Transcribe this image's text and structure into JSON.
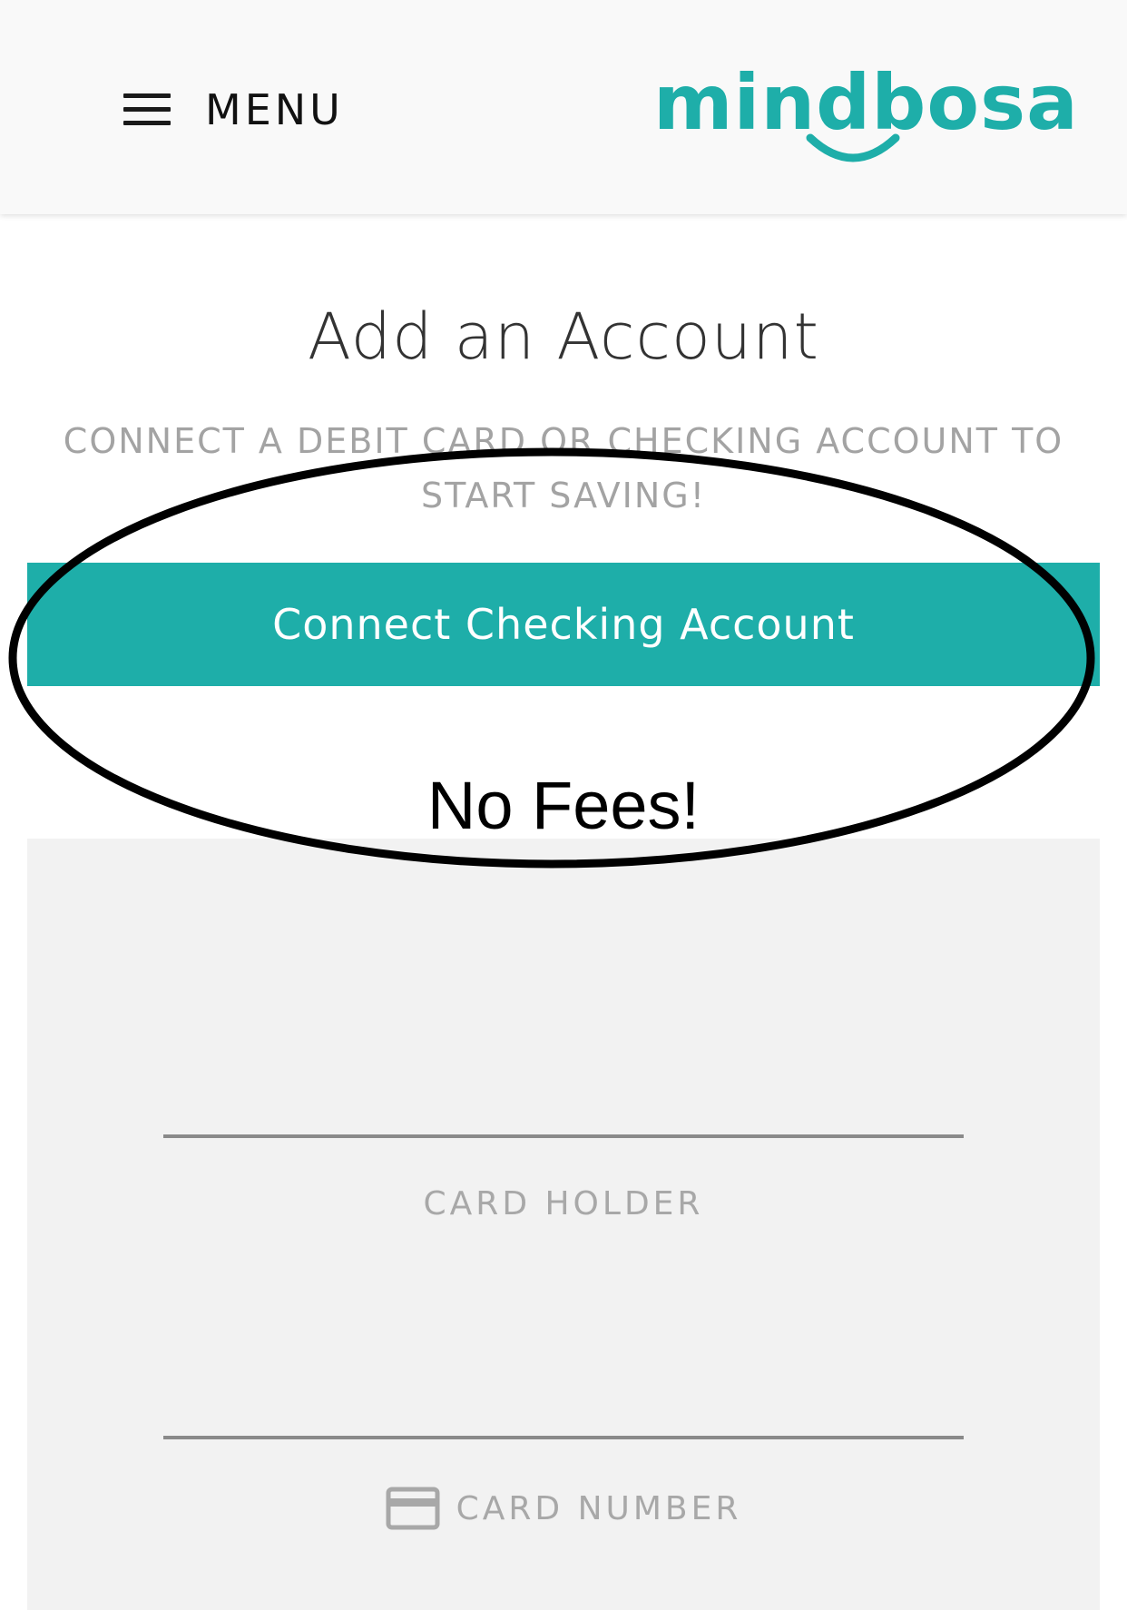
{
  "header": {
    "menu_label": "MENU",
    "logo_text": "mindbosa"
  },
  "main": {
    "title": "Add an Account",
    "subtitle": "CONNECT A DEBIT CARD OR CHECKING ACCOUNT TO START SAVING!",
    "connect_button_label": "Connect Checking Account",
    "annotation_text": "No Fees!"
  },
  "card_form": {
    "card_holder_label": "CARD HOLDER",
    "card_number_label": "CARD NUMBER",
    "card_holder_value": "",
    "card_number_value": ""
  },
  "colors": {
    "brand": "#1eaea9",
    "header_bg": "#f9f9f9",
    "panel_bg": "#f2f2f2",
    "muted_text": "#a3a3a3"
  },
  "icons": {
    "menu": "hamburger-icon",
    "card": "credit-card-icon"
  }
}
